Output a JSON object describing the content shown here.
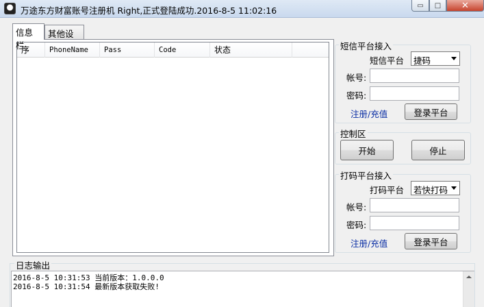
{
  "window": {
    "title": "万途东方财富账号注册机      Right,正式登陆成功.2016-8-5 11:02:16",
    "min_glyph": "▭",
    "max_glyph": "□",
    "close_glyph": "✕"
  },
  "tabs": [
    {
      "label": "信息栏",
      "active": true
    },
    {
      "label": "其他设置",
      "active": false
    }
  ],
  "table": {
    "columns": [
      "序",
      "PhoneName",
      "Pass",
      "Code",
      "状态"
    ],
    "rows": []
  },
  "sms_platform": {
    "group_title": "短信平台接入",
    "platform_label": "短信平台",
    "platform_value": "捷码",
    "account_label": "帐号:",
    "account_value": "",
    "password_label": "密码:",
    "password_value": "",
    "register_link": "注册/充值",
    "login_button": "登录平台"
  },
  "control": {
    "group_title": "控制区",
    "start_button": "开始",
    "stop_button": "停止"
  },
  "captcha_platform": {
    "group_title": "打码平台接入",
    "platform_label": "打码平台",
    "platform_value": "若快打码",
    "account_label": "帐号:",
    "account_value": "",
    "password_label": "密码:",
    "password_value": "",
    "register_link": "注册/充值",
    "login_button": "登录平台"
  },
  "log": {
    "group_title": "日志输出",
    "lines": [
      "2016-8-5 10:31:53 当前版本：1.0.0.0",
      "2016-8-5 10:31:54 最新版本获取失败!"
    ]
  },
  "colors": {
    "link": "#0a2ea4",
    "close_button": "#c7432c"
  },
  "icons": {
    "app_icon": "app-icon",
    "combo_arrow": "chevron-down-icon",
    "scroll_up": "scroll-up-icon"
  }
}
